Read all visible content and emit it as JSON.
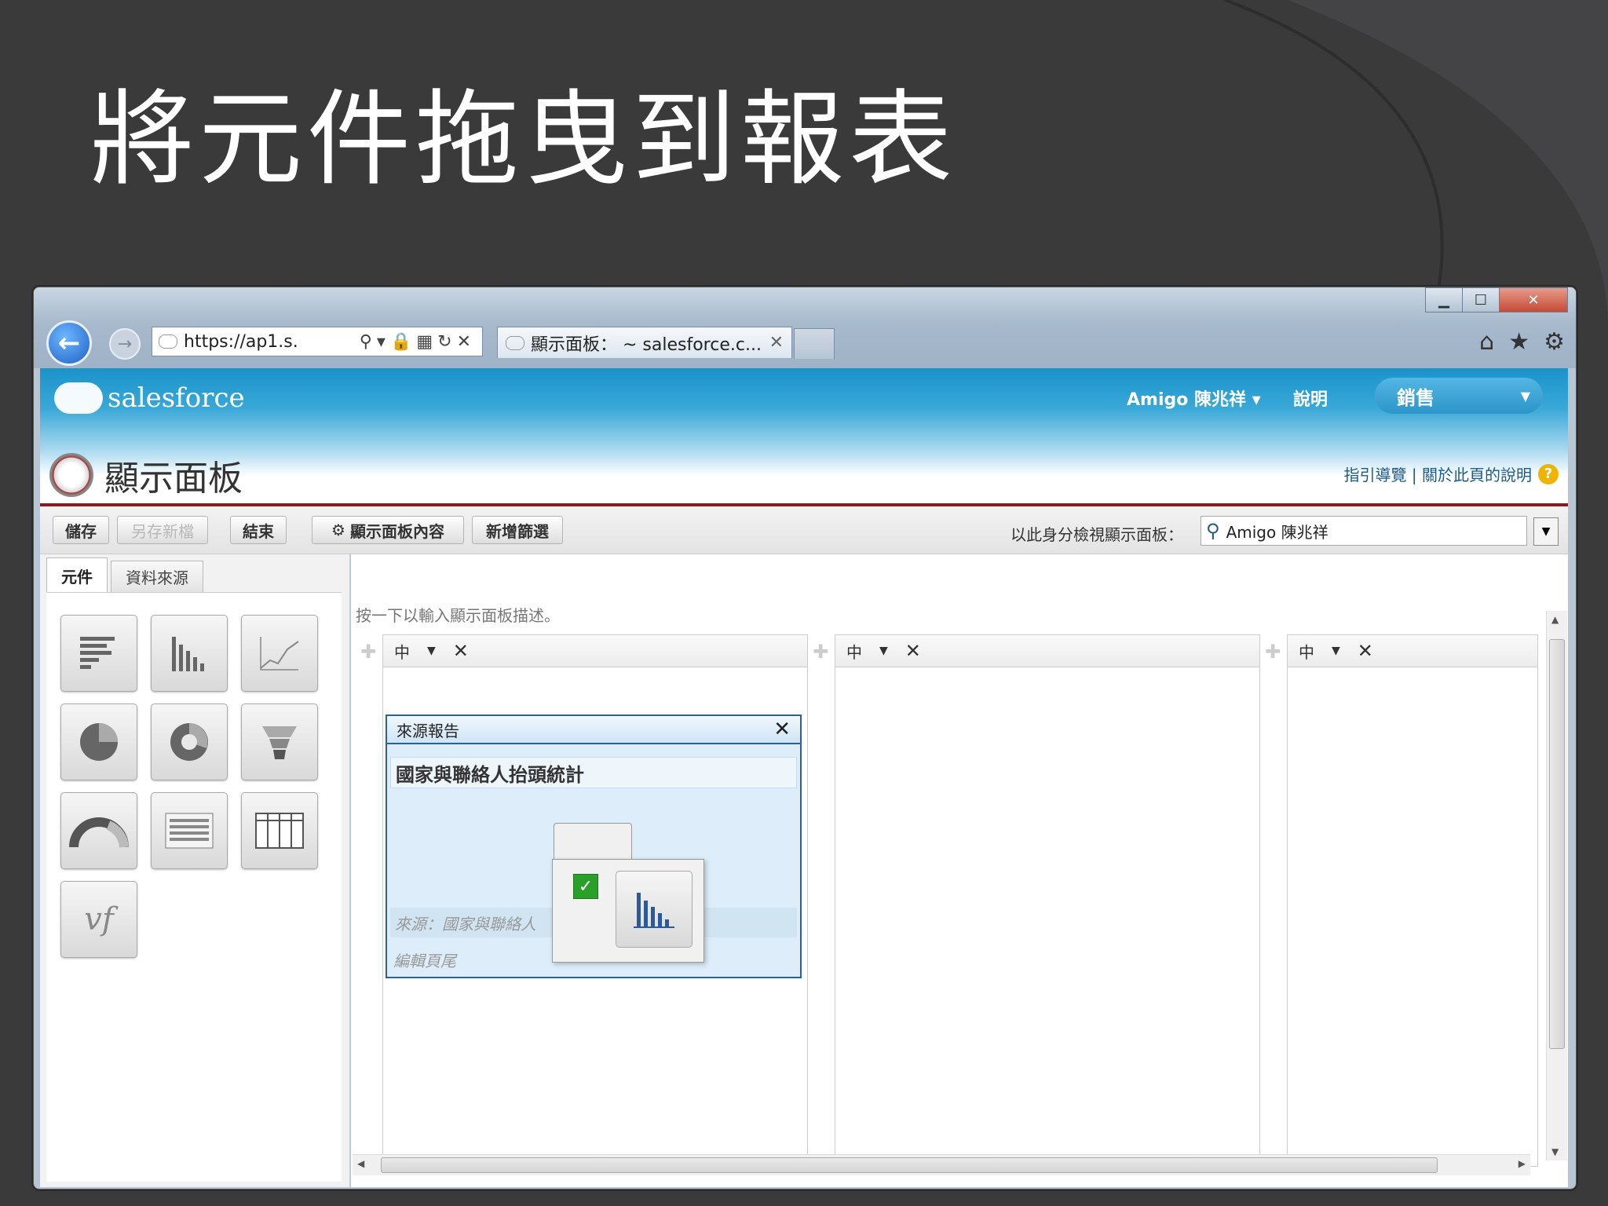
{
  "slide": {
    "title": "將元件拖曳到報表"
  },
  "browser": {
    "address": "https://ap1.s.",
    "address_tools": "⚲▾🔒▦↻✕",
    "tab_label": "顯示面板： ~ salesforce.c...",
    "tab_close": "✕",
    "window_controls": {
      "minimize": "▁",
      "maximize": "☐",
      "close": "✕"
    },
    "right_tools": {
      "home": "⌂",
      "star": "★",
      "gear": "⚙"
    }
  },
  "header": {
    "logo_text": "salesforce",
    "user_menu": "Amigo 陳兆祥 ▾",
    "help": "說明",
    "app_selector": "銷售",
    "page_title": "顯示面板",
    "help_links": "指引導覽 | 關於此頁的說明"
  },
  "toolbar": {
    "save": "儲存",
    "save_as": "另存新檔",
    "close": "結束",
    "properties": "顯示面板內容",
    "add_filter": "新增篩選",
    "view_as_label": "以此身分檢視顯示面板：",
    "view_as_value": "Amigo 陳兆祥"
  },
  "left_panel": {
    "tabs": [
      {
        "label": "元件"
      },
      {
        "label": "資料來源"
      }
    ],
    "components": [
      {
        "icon": "horizontal-bar-chart-icon"
      },
      {
        "icon": "vertical-bar-chart-icon"
      },
      {
        "icon": "line-chart-icon"
      },
      {
        "icon": "pie-chart-icon"
      },
      {
        "icon": "donut-chart-icon"
      },
      {
        "icon": "funnel-chart-icon"
      },
      {
        "icon": "gauge-icon"
      },
      {
        "icon": "metric-icon"
      },
      {
        "icon": "table-icon"
      },
      {
        "icon": "visualforce-icon",
        "label": "vf"
      }
    ]
  },
  "main": {
    "description": "按一下以輸入顯示面板描述。",
    "columns": [
      {
        "size": "中"
      },
      {
        "size": "中"
      },
      {
        "size": "中"
      }
    ],
    "source_box": {
      "header": "來源報告",
      "report_title": "國家與聯絡人抬頭統計",
      "source_label": "來源：國家與聯絡人",
      "edit_footer": "編輯頁尾"
    }
  }
}
